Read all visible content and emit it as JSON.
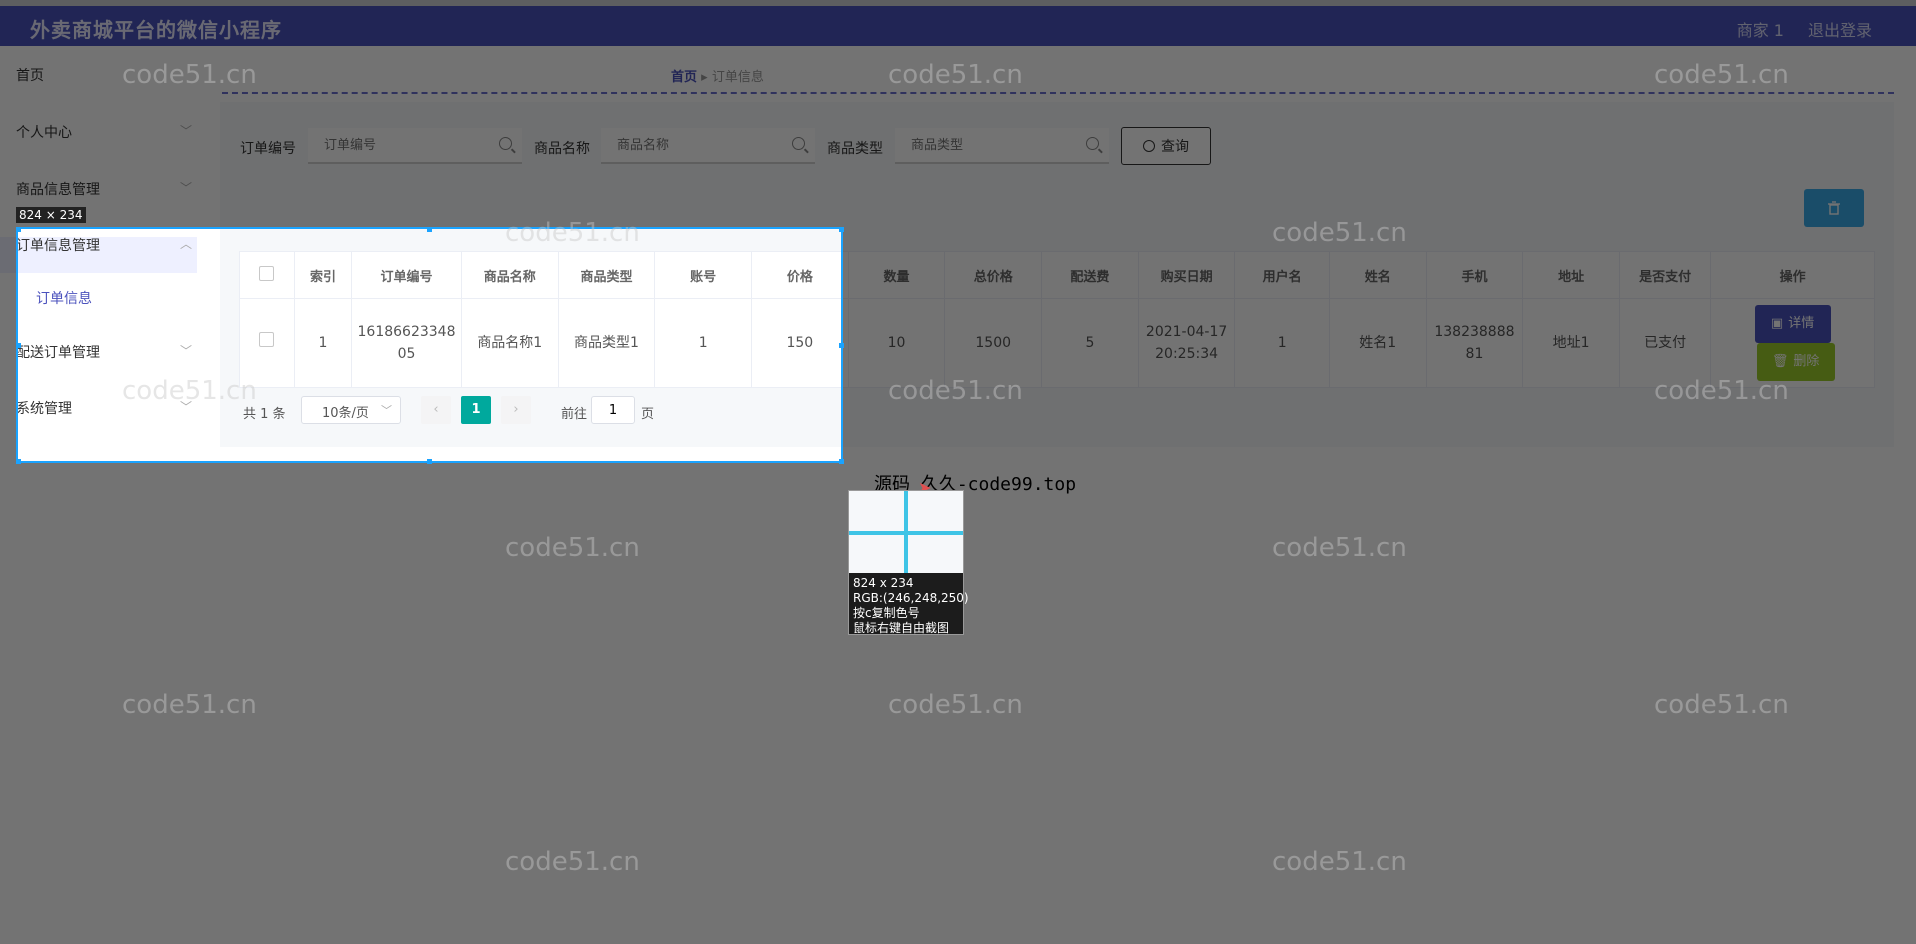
{
  "app": {
    "title": "外卖商城平台的微信小程序",
    "user": "商家 1",
    "logout": "退出登录"
  },
  "sidebar": {
    "items": [
      {
        "label": "首页"
      },
      {
        "label": "个人中心"
      },
      {
        "label": "商品信息管理"
      },
      {
        "label": "订单信息管理"
      },
      {
        "label": "订单信息"
      },
      {
        "label": "配送订单管理"
      },
      {
        "label": "系统管理"
      }
    ]
  },
  "breadcrumb": {
    "home": "首页",
    "current": "订单信息"
  },
  "search": {
    "order_no_label": "订单编号",
    "order_no_placeholder": "订单编号",
    "product_name_label": "商品名称",
    "product_name_placeholder": "商品名称",
    "product_type_label": "商品类型",
    "product_type_placeholder": "商品类型",
    "query_label": "查询"
  },
  "table": {
    "headers": [
      "索引",
      "订单编号",
      "商品名称",
      "商品类型",
      "账号",
      "价格",
      "数量",
      "总价格",
      "配送费",
      "购买日期",
      "用户名",
      "姓名",
      "手机",
      "地址",
      "是否支付",
      "操作"
    ],
    "rows": [
      {
        "index": "1",
        "order_no": "1618662334805",
        "product_name": "商品名称1",
        "product_type": "商品类型1",
        "account": "1",
        "price": "150",
        "quantity": "10",
        "total": "1500",
        "delivery_fee": "5",
        "purchase_date": "2021-04-17 20:25:34",
        "username": "1",
        "name": "姓名1",
        "phone": "13823888881",
        "address": "地址1",
        "paid": "已支付",
        "detail_label": "详情",
        "delete_label": "删除"
      }
    ]
  },
  "pagination": {
    "total": "共 1 条",
    "page_size": "10条/页",
    "current_page": "1",
    "goto_label": "前往",
    "goto_value": "1",
    "page_suffix": "页"
  },
  "screenshot_tool": {
    "size_tag": "824 × 234",
    "source_text": "源码 久久-code99.top",
    "info_size": "824 x 234",
    "info_rgb": "RGB:(246,248,250)",
    "info_copy": "按c复制色号",
    "info_capture": "鼠标右键自由截图"
  },
  "watermark": "code51.cn",
  "colors": {
    "header": "#4b52bd",
    "detail_button": "#4b52bd",
    "delete_button": "#9ccc2c",
    "pagination_active": "#00a99d",
    "bulk_delete_button": "#3aaae8",
    "capture_border": "#1aa3ff"
  }
}
